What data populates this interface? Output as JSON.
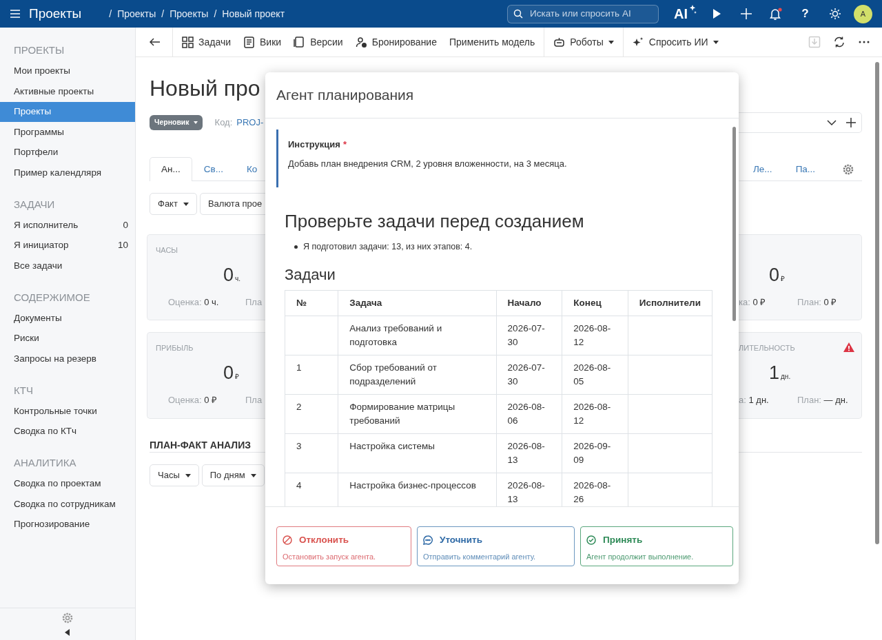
{
  "topbar": {
    "app_title": "Проекты",
    "breadcrumb": {
      "separator": "/",
      "items": [
        "Проекты",
        "Проекты",
        "Новый проект"
      ]
    },
    "search": {
      "placeholder": "Искать или спросить AI"
    },
    "ai_label": "AI",
    "help_label": "?",
    "notification_unread": true,
    "avatar": "A"
  },
  "sidebar": {
    "sections": [
      {
        "title": "ПРОЕКТЫ",
        "items": [
          {
            "label": "Мои проекты",
            "selected": false
          },
          {
            "label": "Активные проекты",
            "selected": false
          },
          {
            "label": "Проекты",
            "selected": true
          },
          {
            "label": "Программы",
            "selected": false
          },
          {
            "label": "Портфели",
            "selected": false
          },
          {
            "label": "Пример календляря",
            "selected": false
          }
        ]
      },
      {
        "title": "ЗАДАЧИ",
        "items": [
          {
            "label": "Я исполнитель",
            "count": "0",
            "selected": false
          },
          {
            "label": "Я инициатор",
            "count": "10",
            "selected": false
          },
          {
            "label": "Все задачи",
            "selected": false
          }
        ]
      },
      {
        "title": "СОДЕРЖИМОЕ",
        "items": [
          {
            "label": "Документы",
            "selected": false
          },
          {
            "label": "Риски",
            "selected": false
          },
          {
            "label": "Запросы на резерв",
            "selected": false
          }
        ]
      },
      {
        "title": "КТЧ",
        "items": [
          {
            "label": "Контрольные точки",
            "selected": false
          },
          {
            "label": "Сводка по КТч",
            "selected": false
          }
        ]
      },
      {
        "title": "АНАЛИТИКА",
        "items": [
          {
            "label": "Сводка по проектам",
            "selected": false
          },
          {
            "label": "Сводка по сотрудникам",
            "selected": false
          },
          {
            "label": "Прогнозирование",
            "selected": false
          }
        ]
      }
    ]
  },
  "toolbar": {
    "groups": [
      [
        {
          "label": "Задачи",
          "dropdown": false
        },
        {
          "label": "Вики",
          "dropdown": false
        },
        {
          "label": "Версии",
          "dropdown": false
        },
        {
          "label": "Бронирование",
          "dropdown": false
        },
        {
          "label": "Применить модель",
          "dropdown": false
        }
      ],
      [
        {
          "label": "Роботы",
          "dropdown": true
        }
      ],
      [
        {
          "label": "Спросить ИИ",
          "dropdown": true
        }
      ]
    ],
    "actions": [
      {
        "disabled": true
      },
      {
        "disabled": false
      },
      {
        "disabled": false
      }
    ]
  },
  "page": {
    "title": "Новый про",
    "status": "Черновик",
    "code_label": "Код:",
    "code_value": "PROJ-",
    "tabs": [
      {
        "label": "Ан...",
        "selected": true
      },
      {
        "label": "Св...",
        "selected": false
      },
      {
        "label": "Ко",
        "selected": false
      }
    ],
    "tabs_right": [
      {
        "label": "Ле...",
        "selected": false
      },
      {
        "label": "Па...",
        "selected": false
      }
    ],
    "filters": [
      {
        "label": "Факт",
        "dropdown": true
      },
      {
        "label": "Валюта прое",
        "dropdown": false
      }
    ],
    "cards_left": [
      {
        "label": "ЧАСЫ",
        "value": "0",
        "unit": "ч.",
        "estimate_label": "Оценка:",
        "estimate_value": "0 ч.",
        "plan_label": "Пла"
      },
      {
        "label": "ПРИБЫЛЬ",
        "value": "0",
        "unit": "₽",
        "estimate_label": "Оценка:",
        "estimate_value": "0 ₽",
        "plan_label": "Пла"
      }
    ],
    "cards_right": [
      {
        "value": "0",
        "unit": "₽",
        "estimate_label": "ка:",
        "estimate_value": "0 ₽",
        "plan_label": "План:",
        "plan_value": "0 ₽",
        "warning": false
      },
      {
        "label": "ЛИТЕЛЬНОСТЬ",
        "value": "1",
        "unit": "дн.",
        "estimate_label": "а:",
        "estimate_value": "1 дн.",
        "plan_label": "План:",
        "plan_value": "— дн.",
        "warning": true
      }
    ],
    "section_title": "ПЛАН-ФАКТ АНАЛИЗ",
    "section_filters": [
      {
        "label": "Часы",
        "dropdown": true
      },
      {
        "label": "По дням",
        "dropdown": true
      }
    ]
  },
  "modal": {
    "title": "Агент планирования",
    "instruction": {
      "label": "Инструкция",
      "required_mark": "*",
      "text": "Добавь план внедрения CRM, 2 уровня вложенности, на 3 месяца."
    },
    "heading": "Проверьте задачи перед созданием",
    "bullets": [
      "Я подготовил задачи: 13, из них этапов: 4."
    ],
    "tasks_heading": "Задачи",
    "table": {
      "columns": [
        "№",
        "Задача",
        "Начало",
        "Конец",
        "Исполнители"
      ],
      "rows": [
        {
          "task": "Анализ требований и подготовка",
          "start": "2026-07-30",
          "end": "2026-08-12"
        },
        {
          "number": "1",
          "task": "Сбор требований от подразделений",
          "start": "2026-07-30",
          "end": "2026-08-05"
        },
        {
          "number": "2",
          "task": "Формирование матрицы требований",
          "start": "2026-08-06",
          "end": "2026-08-12"
        },
        {
          "number": "3",
          "task": "Настройка системы",
          "start": "2026-08-13",
          "end": "2026-09-09"
        },
        {
          "number": "4",
          "task": "Настройка бизнес-процессов",
          "start": "2026-08-13",
          "end": "2026-08-26"
        }
      ]
    },
    "actions": [
      {
        "kind": "reject",
        "title": "Отклонить",
        "subtitle": "Остановить запуск агента."
      },
      {
        "kind": "clarify",
        "title": "Уточнить",
        "subtitle": "Отправить комментарий агенту."
      },
      {
        "kind": "accept",
        "title": "Принять",
        "subtitle": "Агент продолжит выполнение."
      }
    ]
  }
}
